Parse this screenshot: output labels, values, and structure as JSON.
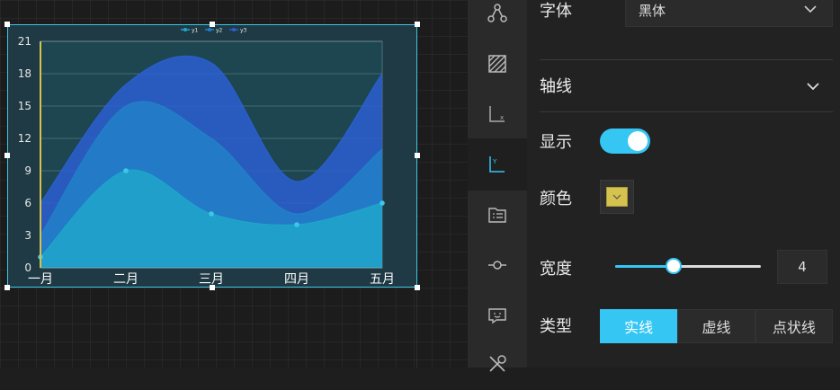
{
  "colors": {
    "accent": "#35c6f4",
    "axis_color": "#d6c34f",
    "series": [
      "#1fa6c9",
      "#2280c9",
      "#2a5fd0"
    ]
  },
  "chart_data": {
    "type": "area",
    "categories": [
      "一月",
      "二月",
      "三月",
      "四月",
      "五月"
    ],
    "series": [
      {
        "name": "y1",
        "values": [
          1,
          9,
          5,
          4,
          6
        ]
      },
      {
        "name": "y2",
        "values": [
          2,
          6,
          7,
          1,
          5
        ]
      },
      {
        "name": "y3",
        "values": [
          3,
          2,
          7,
          3,
          7
        ]
      }
    ],
    "y_ticks": [
      "0",
      "3",
      "6",
      "9",
      "12",
      "15",
      "18",
      "21"
    ],
    "ylim": [
      0,
      21
    ],
    "stacked": true,
    "smooth": true,
    "grid": true,
    "legend": "top-center"
  },
  "sidebar": {
    "icons": [
      "share-nodes-icon",
      "pattern-fill-icon",
      "x-axis-icon",
      "y-axis-icon",
      "legend-list-icon",
      "marker-point-icon",
      "tooltip-icon",
      "tools-icon"
    ]
  },
  "panel": {
    "font_label": "字体",
    "font_value": "黑体",
    "axis_section": "轴线",
    "show_label": "显示",
    "color_label": "颜色",
    "width_label": "宽度",
    "width_value": "4",
    "width_slider_fraction": 0.4,
    "type_label": "类型",
    "type_options": [
      "实线",
      "虚线",
      "点状线"
    ],
    "type_selected": "实线"
  }
}
